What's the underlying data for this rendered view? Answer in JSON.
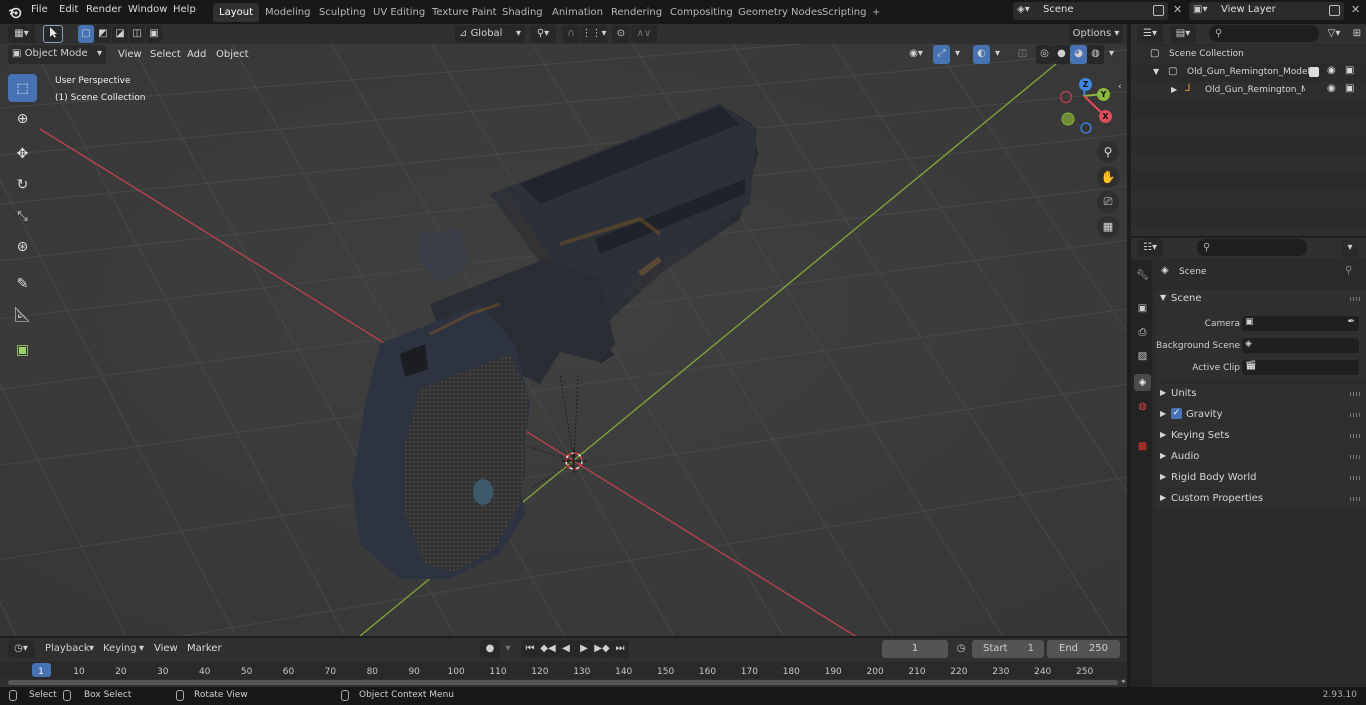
{
  "topbar": {
    "menus": [
      "File",
      "Edit",
      "Render",
      "Window",
      "Help"
    ],
    "workspaces": [
      "Layout",
      "Modeling",
      "Sculpting",
      "UV Editing",
      "Texture Paint",
      "Shading",
      "Animation",
      "Rendering",
      "Compositing",
      "Geometry Nodes",
      "Scripting"
    ],
    "active_workspace": "Layout",
    "add_workspace": "+",
    "scene_name": "Scene",
    "view_layer_name": "View Layer"
  },
  "tool_header": {
    "orientation": "Global",
    "options_label": "Options"
  },
  "viewport_header": {
    "mode": "Object Mode",
    "menus": [
      "View",
      "Select",
      "Add",
      "Object"
    ]
  },
  "viewport": {
    "perspective_label": "User Perspective",
    "collection_label": "(1) Scene Collection",
    "gizmo_axes": {
      "x": "X",
      "y": "Y",
      "z": "Z"
    },
    "colors": {
      "x_axis": "#e04b5c",
      "y_axis": "#8bb83d",
      "z_axis": "#3f87de",
      "bg": "#3d3d3d"
    }
  },
  "outliner": {
    "root": "Scene Collection",
    "items": [
      {
        "label": "Old_Gun_Remington_Model_C"
      },
      {
        "label": "Old_Gun_Remington_Mo"
      }
    ]
  },
  "properties": {
    "header": "Scene",
    "panel_title": "Scene",
    "fields": [
      {
        "label": "Camera"
      },
      {
        "label": "Background Scene"
      },
      {
        "label": "Active Clip"
      }
    ],
    "sections": [
      "Units",
      "Gravity",
      "Keying Sets",
      "Audio",
      "Rigid Body World",
      "Custom Properties"
    ],
    "gravity_checked": true
  },
  "timeline": {
    "menus": [
      "Playback",
      "Keying",
      "View",
      "Marker"
    ],
    "current_frame": "1",
    "start_label": "Start",
    "start_value": "1",
    "end_label": "End",
    "end_value": "250",
    "ruler": [
      "1",
      "10",
      "20",
      "30",
      "40",
      "50",
      "60",
      "70",
      "80",
      "90",
      "100",
      "110",
      "120",
      "130",
      "140",
      "150",
      "160",
      "170",
      "180",
      "190",
      "200",
      "210",
      "220",
      "230",
      "240",
      "250"
    ]
  },
  "statusbar": {
    "items": [
      "Select",
      "Box Select",
      "Rotate View",
      "Object Context Menu"
    ],
    "version": "2.93.10"
  }
}
